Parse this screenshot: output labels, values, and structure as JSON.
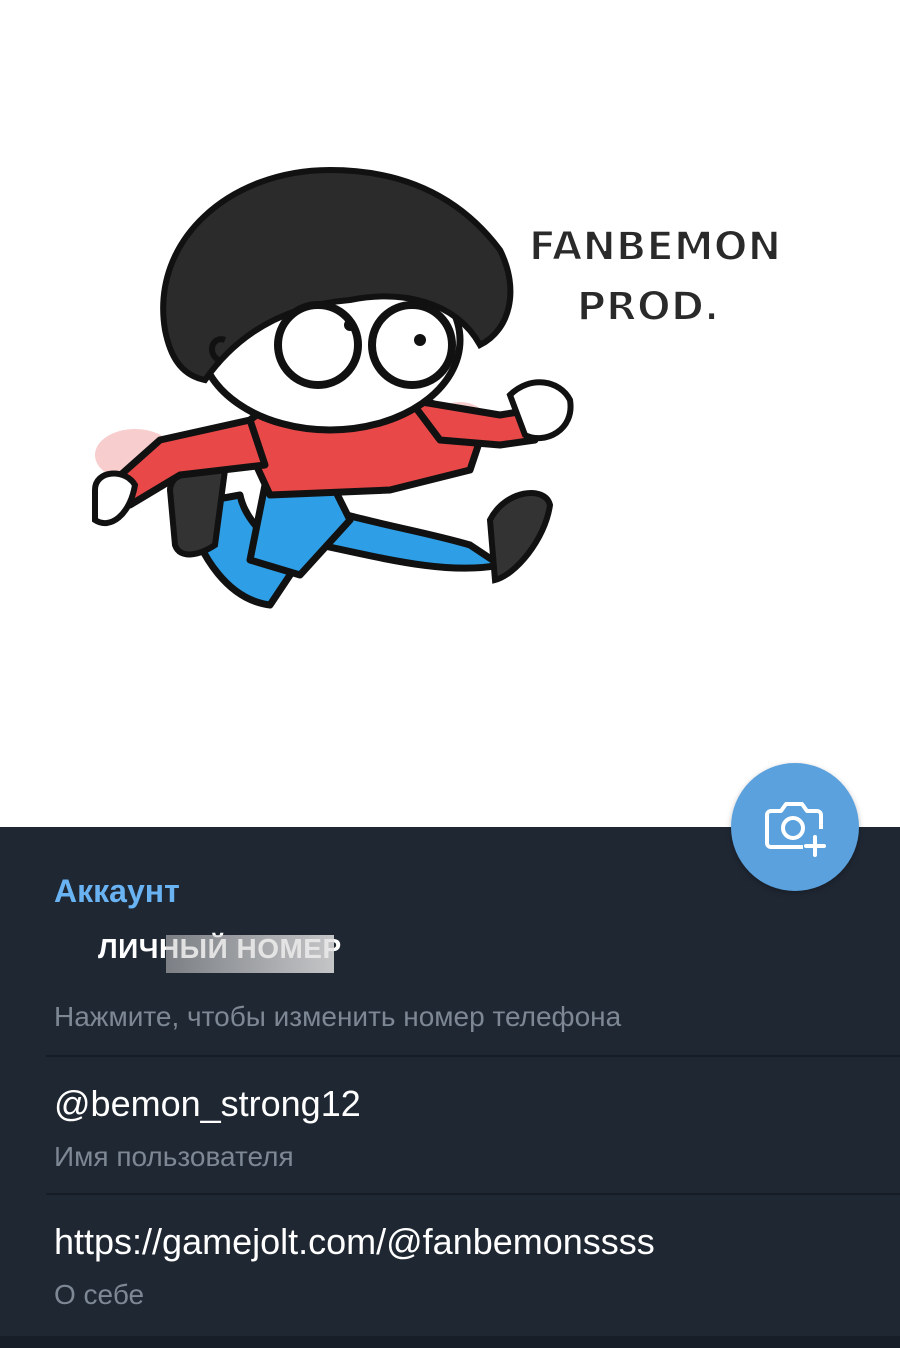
{
  "hero": {
    "sticker_text_line1": "FANBEMON",
    "sticker_text_line2": "PROD."
  },
  "fab": {
    "icon": "camera-add-icon",
    "color": "#5aa1de"
  },
  "account": {
    "section_title": "Аккаунт",
    "phone_value": "ЛИЧНЫЙ НОМЕР",
    "phone_hint": "Нажмите, чтобы изменить номер телефона",
    "username_value": "@bemon_strong12",
    "username_label": "Имя пользователя",
    "bio_value": "https://gamejolt.com/@fanbemonssss",
    "bio_label": "О себе"
  },
  "colors": {
    "panel_bg": "#1f2733",
    "accent": "#6ab3f3",
    "secondary_text": "#7d8894"
  }
}
